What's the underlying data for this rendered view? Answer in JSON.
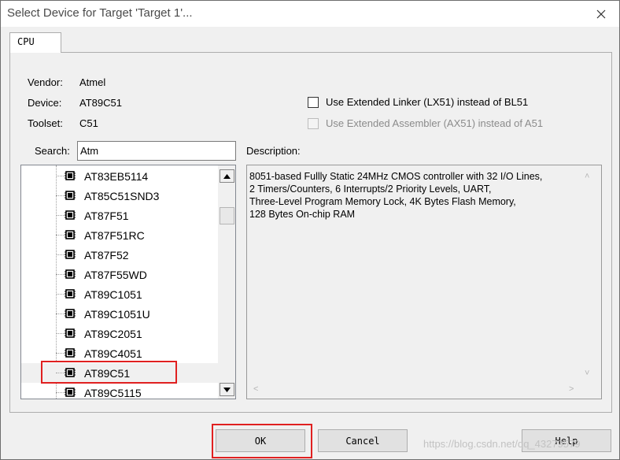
{
  "window": {
    "title": "Select Device for Target 'Target 1'..."
  },
  "tab": {
    "label": "CPU"
  },
  "info": {
    "vendor_label": "Vendor:",
    "vendor_value": "Atmel",
    "device_label": "Device:",
    "device_value": "AT89C51",
    "toolset_label": "Toolset:",
    "toolset_value": "C51"
  },
  "options": {
    "lx51_label": "Use Extended Linker (LX51) instead of BL51",
    "lx51_checked": false,
    "ax51_label": "Use Extended Assembler (AX51) instead of A51",
    "ax51_checked": false,
    "ax51_enabled": false
  },
  "search": {
    "label": "Search:",
    "value": "Atm"
  },
  "devices": {
    "items": [
      "AT83EB5114",
      "AT85C51SND3",
      "AT87F51",
      "AT87F51RC",
      "AT87F52",
      "AT87F55WD",
      "AT89C1051",
      "AT89C1051U",
      "AT89C2051",
      "AT89C4051",
      "AT89C51",
      "AT89C5115"
    ],
    "selected": "AT89C51"
  },
  "description": {
    "label": "Description:",
    "text": "8051-based Fullly Static 24MHz CMOS controller with 32  I/O Lines,\n2 Timers/Counters, 6 Interrupts/2 Priority Levels, UART,\nThree-Level Program Memory Lock, 4K Bytes Flash Memory,\n128 Bytes On-chip RAM"
  },
  "buttons": {
    "ok": "OK",
    "cancel": "Cancel",
    "help": "Help"
  },
  "watermark": "https://blog.csdn.net/qq_43279579",
  "colors": {
    "highlight": "#e02020",
    "window_bg": "#f0f0f0"
  }
}
